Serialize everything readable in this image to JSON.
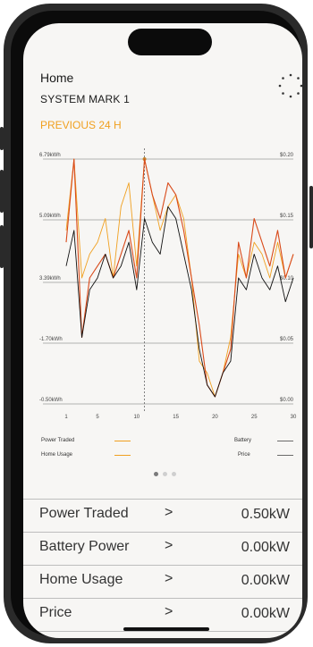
{
  "header": {
    "home_label": "Home",
    "system_name": "SYSTEM MARK 1",
    "period_label": "PREVIOUS 24 H",
    "menu_icon": "dots-circle-icon"
  },
  "colors": {
    "accent_orange": "#f0a020",
    "power_traded_line": "#f0a020",
    "home_usage_line": "#d94a1a",
    "battery_line": "#111111",
    "price_line": "#6a6a6a"
  },
  "chart_data": {
    "type": "line",
    "x_ticks": [
      "1",
      "5",
      "10",
      "15",
      "20",
      "25",
      "30"
    ],
    "y_left_ticks": [
      "6.79kWh",
      "5.09kWh",
      "3.39kWh",
      "-1.70kWh",
      "-0.50kWh"
    ],
    "y_right_ticks": [
      "$0.20",
      "$0.15",
      "$0.10",
      "$0.05",
      "$0.00"
    ],
    "marker_x": 11,
    "series": [
      {
        "name": "Power Traded",
        "x": [
          1,
          2,
          3,
          4,
          5,
          6,
          7,
          8,
          9,
          10,
          11,
          12,
          13,
          14,
          15,
          16,
          17,
          18,
          19,
          20,
          21,
          22,
          23,
          24,
          25,
          26,
          27,
          28,
          29,
          30
        ],
        "values": [
          0.14,
          0.2,
          0.1,
          0.12,
          0.13,
          0.15,
          0.1,
          0.16,
          0.18,
          0.11,
          0.2,
          0.17,
          0.14,
          0.16,
          0.17,
          0.15,
          0.1,
          0.03,
          0.02,
          0.0,
          0.02,
          0.05,
          0.12,
          0.1,
          0.13,
          0.12,
          0.1,
          0.13,
          0.1,
          0.12
        ]
      },
      {
        "name": "Home Usage",
        "x": [
          1,
          2,
          3,
          4,
          5,
          6,
          7,
          8,
          9,
          10,
          11,
          12,
          13,
          14,
          15,
          16,
          17,
          18,
          19,
          20,
          21,
          22,
          23,
          24,
          25,
          26,
          27,
          28,
          29,
          30
        ],
        "values": [
          0.13,
          0.2,
          0.05,
          0.1,
          0.11,
          0.12,
          0.1,
          0.12,
          0.14,
          0.1,
          0.2,
          0.17,
          0.15,
          0.18,
          0.17,
          0.14,
          0.1,
          0.06,
          0.01,
          0.0,
          0.02,
          0.04,
          0.13,
          0.1,
          0.15,
          0.13,
          0.11,
          0.14,
          0.1,
          0.12
        ]
      },
      {
        "name": "Battery",
        "x": [
          1,
          2,
          3,
          4,
          5,
          6,
          7,
          8,
          9,
          10,
          11,
          12,
          13,
          14,
          15,
          16,
          17,
          18,
          19,
          20,
          21,
          22,
          23,
          24,
          25,
          26,
          27,
          28,
          29,
          30
        ],
        "values": [
          0.11,
          0.14,
          0.05,
          0.09,
          0.1,
          0.12,
          0.1,
          0.11,
          0.13,
          0.09,
          0.15,
          0.13,
          0.12,
          0.16,
          0.15,
          0.12,
          0.09,
          0.04,
          0.01,
          0.0,
          0.02,
          0.03,
          0.1,
          0.09,
          0.12,
          0.1,
          0.09,
          0.11,
          0.08,
          0.1
        ]
      }
    ],
    "ylim": [
      0,
      0.2
    ],
    "xlim": [
      1,
      30
    ]
  },
  "legend": {
    "power_traded": "Power Traded",
    "home_usage": "Home Usage",
    "battery": "Battery",
    "price": "Price"
  },
  "stats": [
    {
      "label": "Power Traded",
      "chevron": ">",
      "value": "0.50kW"
    },
    {
      "label": "Battery Power",
      "chevron": ">",
      "value": "0.00kW"
    },
    {
      "label": "Home Usage",
      "chevron": ">",
      "value": "0.00kW"
    },
    {
      "label": "Price",
      "chevron": ">",
      "value": "0.00kW"
    }
  ]
}
